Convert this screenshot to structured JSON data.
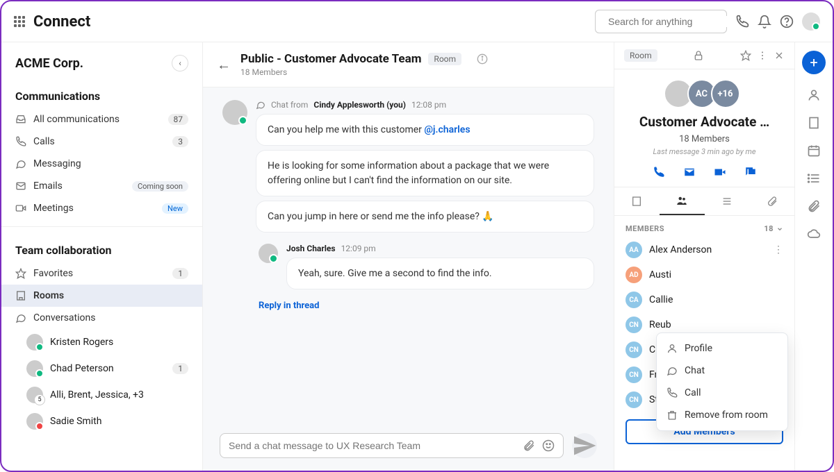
{
  "topbar": {
    "logo": "Connect",
    "search_placeholder": "Search for anything"
  },
  "workspace": {
    "name": "ACME Corp."
  },
  "sidebar": {
    "sections": {
      "communications_title": "Communications",
      "team_collab_title": "Team collaboration"
    },
    "items": {
      "all_comms": {
        "label": "All communications",
        "count": "87"
      },
      "calls": {
        "label": "Calls",
        "count": "3"
      },
      "messaging": {
        "label": "Messaging"
      },
      "emails": {
        "label": "Emails",
        "badge": "Coming soon"
      },
      "meetings": {
        "label": "Meetings",
        "badge": "New"
      },
      "favorites": {
        "label": "Favorites",
        "count": "1"
      },
      "rooms": {
        "label": "Rooms"
      },
      "conversations": {
        "label": "Conversations"
      }
    },
    "conversations": [
      {
        "name": "Kristen Rogers"
      },
      {
        "name": "Chad Peterson",
        "count": "1"
      },
      {
        "name": "Alli, Brent, Jessica, +3"
      },
      {
        "name": "Sadie Smith"
      }
    ]
  },
  "chat": {
    "title": "Public - Customer Advocate Team",
    "tag": "Room",
    "subtitle": "18 Members",
    "threads": [
      {
        "prefix": "Chat from",
        "author": "Cindy Applesworth (you)",
        "time": "12:08 pm",
        "bubbles": [
          {
            "text_pre": "Can you help me with this customer ",
            "mention": "@j.charles"
          },
          {
            "text": "He is looking for some information about a package that we were offering online but I can't find the information on our site."
          },
          {
            "text": "Can you jump in here or send me the info please? 🙏"
          }
        ]
      },
      {
        "author": "Josh Charles",
        "time": "12:09 pm",
        "bubbles": [
          {
            "text": "Yeah, sure. Give me a second to find the info."
          }
        ]
      }
    ],
    "reply_link": "Reply in thread",
    "composer_placeholder": "Send a chat message to UX Research Team"
  },
  "right_panel": {
    "tag": "Room",
    "title": "Customer Advocate …",
    "members_line": "18 Members",
    "last_msg": "Last message 3 min ago by me",
    "avatars_more": "+16",
    "avatars_ac": "AC",
    "section_label": "MEMBERS",
    "section_count": "18",
    "members": [
      {
        "initials": "AA",
        "name": "Alex Anderson",
        "color": "#8fc7e8"
      },
      {
        "initials": "AD",
        "name": "Austi",
        "color": "#f6a07a"
      },
      {
        "initials": "CA",
        "name": "Callie",
        "color": "#8fc7e8"
      },
      {
        "initials": "CN",
        "name": "Reub",
        "color": "#8fc7e8"
      },
      {
        "initials": "CN",
        "name": "Chad",
        "color": "#8fc7e8"
      },
      {
        "initials": "CN",
        "name": "Frank Meza",
        "color": "#8fc7e8"
      },
      {
        "initials": "CN",
        "name": "Steve Lowe",
        "color": "#8fc7e8"
      }
    ],
    "add_btn": "Add Members"
  },
  "context_menu": {
    "items": [
      {
        "icon": "user",
        "label": "Profile"
      },
      {
        "icon": "chat",
        "label": "Chat"
      },
      {
        "icon": "phone",
        "label": "Call"
      },
      {
        "icon": "remove",
        "label": "Remove from room"
      }
    ]
  }
}
